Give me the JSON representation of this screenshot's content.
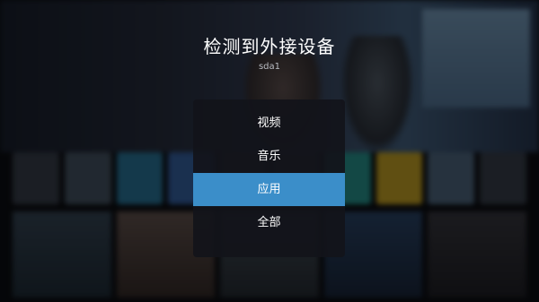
{
  "dialog": {
    "title": "检测到外接设备",
    "device": "sda1",
    "options": [
      {
        "label": "视频",
        "selected": false
      },
      {
        "label": "音乐",
        "selected": false
      },
      {
        "label": "应用",
        "selected": true
      },
      {
        "label": "全部",
        "selected": false
      }
    ]
  },
  "colors": {
    "highlight": "#3b8ec9",
    "menu_bg": "#12141a",
    "text": "#ffffff",
    "subtext": "#b9bcc2"
  }
}
